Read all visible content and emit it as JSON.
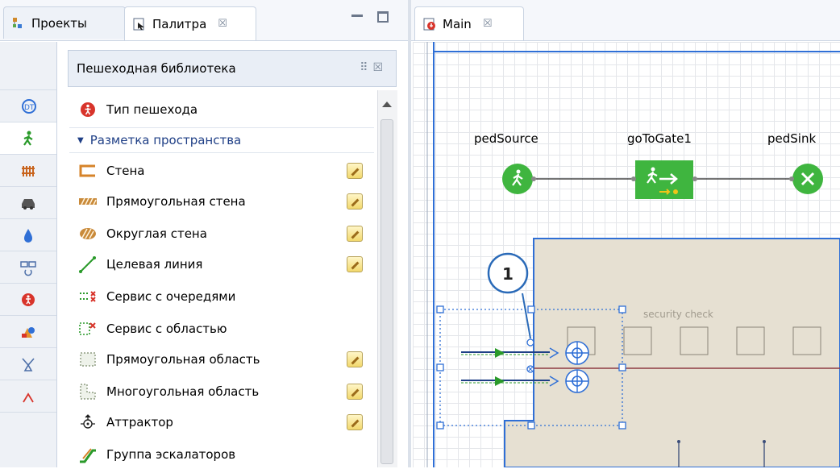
{
  "left_tabs": [
    {
      "label": "Проекты",
      "icon": "projects-icon"
    },
    {
      "label": "Палитра",
      "icon": "palette-icon",
      "close": "☒"
    }
  ],
  "palette": {
    "header": "Пешеходная библиотека",
    "group": "Разметка пространства",
    "items": [
      {
        "label": "Тип пешехода",
        "icon": "pedestrian-type-icon"
      },
      {
        "label": "Стена",
        "icon": "wall-icon",
        "edit": true
      },
      {
        "label": "Прямоугольная стена",
        "icon": "rectangular-wall-icon",
        "edit": true
      },
      {
        "label": "Округлая стена",
        "icon": "round-wall-icon",
        "edit": true
      },
      {
        "label": "Целевая линия",
        "icon": "target-line-icon",
        "edit": true
      },
      {
        "label": "Сервис с очередями",
        "icon": "service-queues-icon"
      },
      {
        "label": "Сервис с областью",
        "icon": "service-area-icon"
      },
      {
        "label": "Прямоугольная область",
        "icon": "rect-area-icon",
        "edit": true
      },
      {
        "label": "Многоугольная область",
        "icon": "polygon-area-icon",
        "edit": true
      },
      {
        "label": "Аттрактор",
        "icon": "attractor-icon",
        "edit": true
      },
      {
        "label": "Группа эскалаторов",
        "icon": "escalator-group-icon"
      }
    ],
    "sidebar_icons": [
      "system-dynamics-icon",
      "pedestrian-icon",
      "rail-icon",
      "car-icon",
      "fluid-icon",
      "process-icon",
      "agent-icon",
      "shapes-icon",
      "connectors-icon",
      "more-icon"
    ]
  },
  "editor": {
    "tab_label": "Main",
    "tab_close": "☒",
    "blocks": [
      {
        "label": "pedSource"
      },
      {
        "label": "goToGate1"
      },
      {
        "label": "pedSink"
      }
    ],
    "area_label": "security check",
    "callout": "1"
  },
  "colors": {
    "accent_blue": "#2f6fd6",
    "green_block": "#3fb53f",
    "callout_border": "#2a6ab8",
    "beige": "#e6e0d2"
  }
}
